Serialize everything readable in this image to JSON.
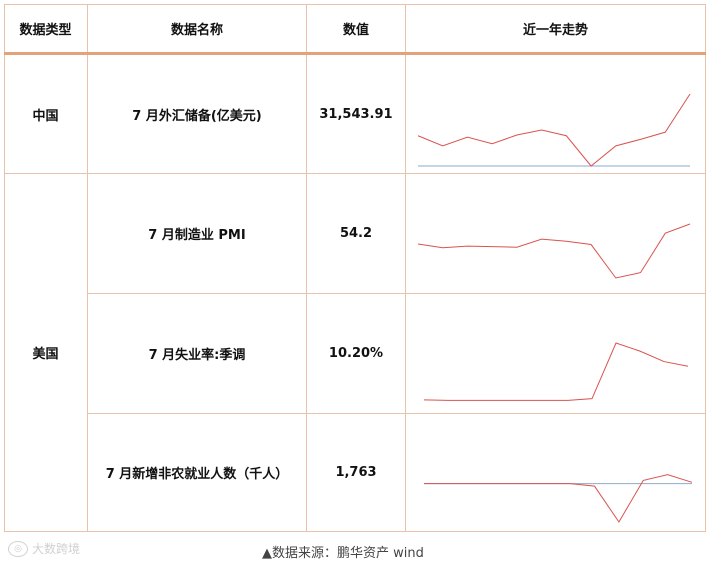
{
  "header": {
    "type": "数据类型",
    "name": "数据名称",
    "value": "数值",
    "trend": "近一年走势"
  },
  "rows": [
    {
      "category": "中国",
      "name": "7 月外汇储备(亿美元)",
      "value": "31,543.91"
    },
    {
      "category": "美国",
      "name": "7 月制造业 PMI",
      "value": "54.2"
    },
    {
      "category": "",
      "name": "7 月失业率:季调",
      "value": "10.20%"
    },
    {
      "category": "",
      "name": "7 月新增非农就业人数（千人）",
      "value": "1,763"
    }
  ],
  "footer": {
    "logo_text": "大数跨境",
    "source": "▲数据来源：鹏华资产  wind"
  },
  "colors": {
    "line": "#d9534f",
    "grid": "#e8c2aa",
    "header_rule": "#e3a277",
    "zero_line": "#8ea9c8"
  },
  "sparklines": [
    {
      "values": [
        0.42,
        0.28,
        0.4,
        0.31,
        0.43,
        0.5,
        0.42,
        0.0,
        0.28,
        0.37,
        0.47,
        1.0
      ],
      "zero": 0.0
    },
    {
      "values": [
        0.63,
        0.56,
        0.59,
        0.58,
        0.57,
        0.72,
        0.68,
        0.62,
        0.0,
        0.1,
        0.83,
        1.0
      ],
      "zero": null
    },
    {
      "values": [
        0.02,
        0.01,
        0.01,
        0.01,
        0.01,
        0.01,
        0.01,
        0.04,
        1.0,
        0.86,
        0.68,
        0.6
      ],
      "zero": null
    },
    {
      "values": [
        0.6,
        0.6,
        0.6,
        0.6,
        0.6,
        0.6,
        0.6,
        0.56,
        0.0,
        0.65,
        0.74,
        0.62
      ],
      "zero": 0.6
    }
  ]
}
